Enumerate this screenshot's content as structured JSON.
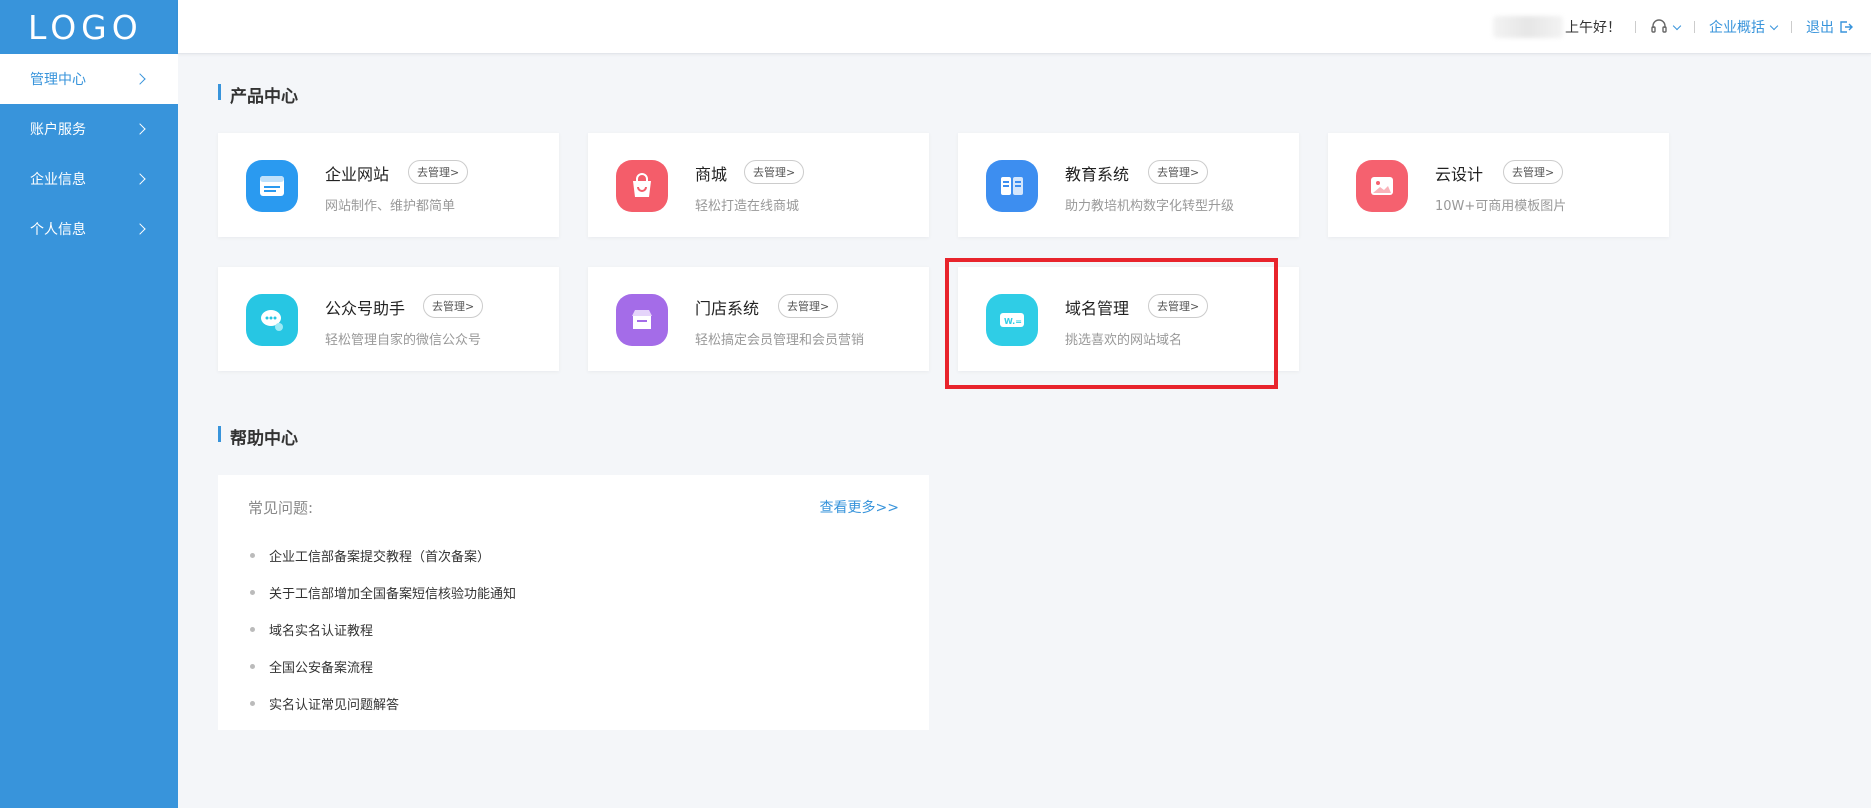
{
  "sidebar": {
    "logo": "LOGO",
    "items": [
      {
        "label": "管理中心",
        "active": true
      },
      {
        "label": "账户服务"
      },
      {
        "label": "企业信息"
      },
      {
        "label": "个人信息"
      }
    ]
  },
  "header": {
    "greeting": "上午好！",
    "overview": "企业概括",
    "logout": "退出"
  },
  "products": {
    "title": "产品中心",
    "manage_label": "去管理>",
    "cards": [
      {
        "name": "企业网站",
        "desc": "网站制作、维护都简单",
        "icon": "website-icon",
        "color": "#2a9af0"
      },
      {
        "name": "商城",
        "desc": "轻松打造在线商城",
        "icon": "shopping-bag-icon",
        "color": "#f45d6a"
      },
      {
        "name": "教育系统",
        "desc": "助力教培机构数字化转型升级",
        "icon": "book-icon",
        "color": "#3d8ef0"
      },
      {
        "name": "云设计",
        "desc": "10W+可商用模板图片",
        "icon": "image-icon",
        "color": "#f5616f"
      },
      {
        "name": "公众号助手",
        "desc": "轻松管理自家的微信公众号",
        "icon": "wechat-icon",
        "color": "#27c6e3"
      },
      {
        "name": "门店系统",
        "desc": "轻松搞定会员管理和会员营销",
        "icon": "store-icon",
        "color": "#a46ce8"
      },
      {
        "name": "域名管理",
        "desc": "挑选喜欢的网站域名",
        "icon": "domain-icon",
        "color": "#2fcde6"
      }
    ]
  },
  "help": {
    "title": "帮助中心",
    "faq_label": "常见问题:",
    "more": "查看更多>>",
    "items": [
      "企业工信部备案提交教程（首次备案）",
      "关于工信部增加全国备案短信核验功能通知",
      "域名实名认证教程",
      "全国公安备案流程",
      "实名认证常见问题解答"
    ]
  }
}
